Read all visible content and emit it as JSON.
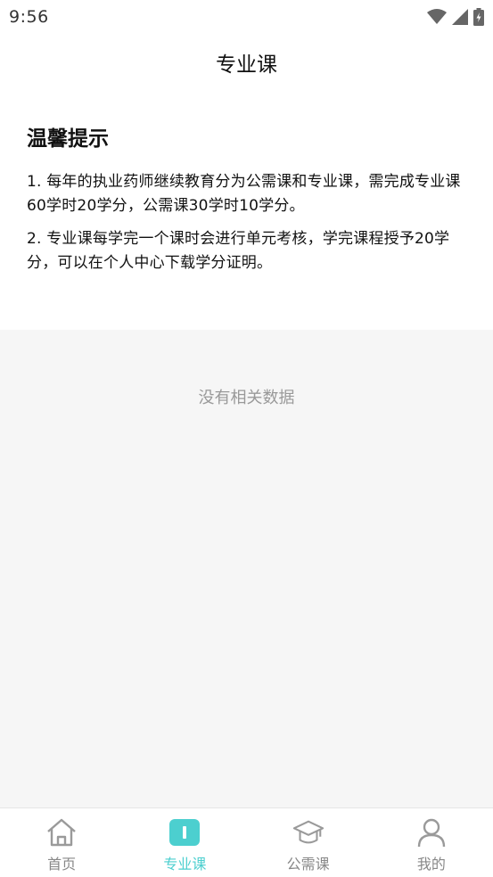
{
  "status_bar": {
    "time": "9:56",
    "icons": [
      "wifi-icon",
      "signal-icon",
      "battery-charging-icon"
    ]
  },
  "header": {
    "title": "专业课"
  },
  "tips": {
    "heading": "温馨提示",
    "lines": [
      "1. 每年的执业药师继续教育分为公需课和专业课，需完成专业课60学时20学分，公需课30学时10学分。",
      "2. 专业课每学完一个课时会进行单元考核，学完课程授予20学分，可以在个人中心下载学分证明。"
    ]
  },
  "empty_state": {
    "text": "没有相关数据"
  },
  "bottom_nav": {
    "items": [
      {
        "label": "首页",
        "icon": "home-icon",
        "active": false
      },
      {
        "label": "专业课",
        "icon": "book-icon",
        "active": true
      },
      {
        "label": "公需课",
        "icon": "graduation-cap-icon",
        "active": false
      },
      {
        "label": "我的",
        "icon": "user-icon",
        "active": false
      }
    ]
  },
  "colors": {
    "accent": "#4ccfcf",
    "inactive": "#888888",
    "empty_background": "#f6f6f6"
  }
}
